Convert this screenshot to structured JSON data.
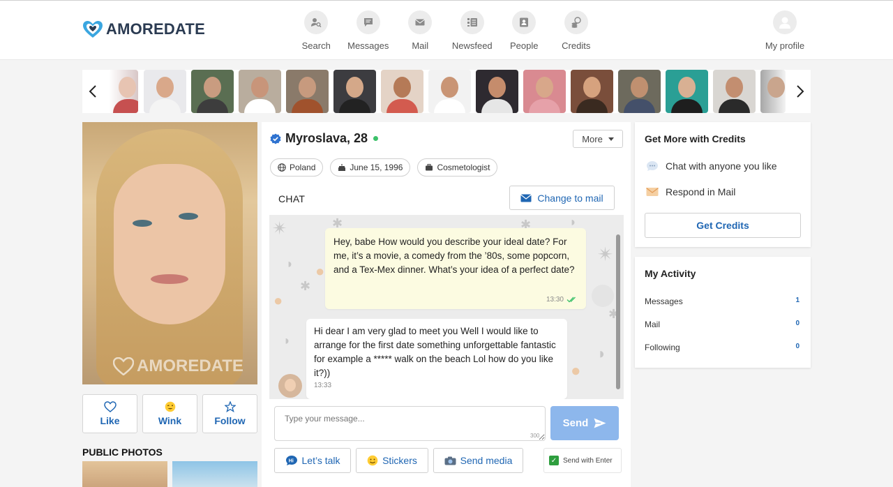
{
  "brand": {
    "name": "AMOREDATE",
    "accent": "#1f66b3"
  },
  "nav": {
    "items": [
      {
        "label": "Search",
        "icon": "search-user-icon"
      },
      {
        "label": "Messages",
        "icon": "chat-bubble-icon"
      },
      {
        "label": "Mail",
        "icon": "envelope-icon"
      },
      {
        "label": "Newsfeed",
        "icon": "newsfeed-icon"
      },
      {
        "label": "People",
        "icon": "person-card-icon"
      },
      {
        "label": "Credits",
        "icon": "coins-icon"
      }
    ],
    "profile_label": "My profile"
  },
  "profile": {
    "name": "Myroslava, 28",
    "online": true,
    "more_label": "More",
    "chips": {
      "country": "Poland",
      "birthday": "June 15, 1996",
      "job": "Cosmetologist"
    },
    "watermark": "AMOREDATE",
    "actions": {
      "like": "Like",
      "wink": "Wink",
      "follow": "Follow"
    },
    "public_photos_title": "PUBLIC PHOTOS"
  },
  "chat": {
    "label": "CHAT",
    "change_to_mail": "Change to mail",
    "messages": [
      {
        "direction": "out",
        "text": "Hey, babe How would you describe your ideal date? For me, it’s a movie, a comedy from the ’80s, some popcorn, and a Tex-Mex dinner. What’s your idea of a perfect date?",
        "time": "13:30"
      },
      {
        "direction": "in",
        "text": "Hi dear I am very glad to meet you Well I would like to arrange for the first date something unforgettable fantastic for example a ***** walk on the beach Lol how do you like it?))",
        "time": "13:33"
      }
    ],
    "input_placeholder": "Type your message...",
    "char_limit": "300",
    "send_label": "Send",
    "tools": {
      "lets_talk": "Let’s talk",
      "stickers": "Stickers",
      "send_media": "Send media"
    },
    "send_with_enter": "Send with Enter"
  },
  "credits_panel": {
    "title": "Get More with Credits",
    "items": [
      "Chat with anyone you like",
      "Respond in Mail"
    ],
    "button": "Get Credits"
  },
  "activity": {
    "title": "My Activity",
    "rows": [
      {
        "label": "Messages",
        "count": "1"
      },
      {
        "label": "Mail",
        "count": "0"
      },
      {
        "label": "Following",
        "count": "0"
      }
    ]
  }
}
